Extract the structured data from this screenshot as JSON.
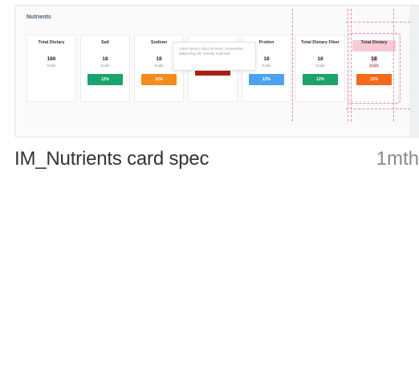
{
  "thumbnail": {
    "section_title": "Nutrients",
    "cards": [
      {
        "label": "Total Dietary",
        "value": "180",
        "unit": "Kcals",
        "badge": "",
        "badge_color": ""
      },
      {
        "label": "Salt",
        "value": "18",
        "unit": "Kcals",
        "badge": "12%",
        "badge_color": "#1aa36a"
      },
      {
        "label": "Sodium",
        "value": "18",
        "unit": "Kcals",
        "badge": "12%",
        "badge_color": "#f28c1c"
      },
      {
        "label": "",
        "value": "",
        "unit": "",
        "badge": "12%",
        "badge_color": "#b01e10"
      },
      {
        "label": "Protien",
        "value": "18",
        "unit": "Kcals",
        "badge": "12%",
        "badge_color": "#4ba3f0"
      },
      {
        "label": "Total Dietary Fiber",
        "value": "18",
        "unit": "Kcals",
        "badge": "12%",
        "badge_color": "#1aa36a"
      },
      {
        "label": "Total Dietary",
        "value": "18",
        "unit": "Kcals",
        "badge": "12%",
        "badge_color": "#f26a1c"
      }
    ],
    "tooltip_text": "Lorem ipsum dolor sit amet, consectetur adipiscing elit. Aenean euismod"
  },
  "caption": {
    "title": "IM_Nutrients card spec",
    "time": "1mth"
  }
}
